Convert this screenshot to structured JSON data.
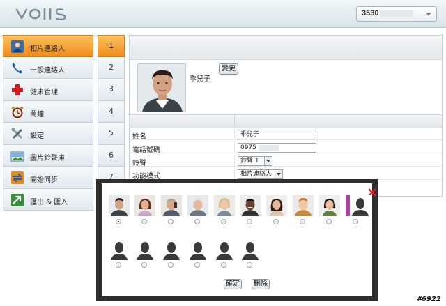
{
  "header": {
    "logo_text": "VOIIS",
    "account_prefix": "3530"
  },
  "sidebar": {
    "items": [
      {
        "label": "相片連絡人",
        "icon": "contact-person-icon",
        "active": true
      },
      {
        "label": "一般連絡人",
        "icon": "phone-icon",
        "active": false
      },
      {
        "label": "健康管理",
        "icon": "health-cross-icon",
        "active": false
      },
      {
        "label": "鬧鐘",
        "icon": "alarm-clock-icon",
        "active": false
      },
      {
        "label": "設定",
        "icon": "tools-icon",
        "active": false
      },
      {
        "label": "圖片鈴聲庫",
        "icon": "image-library-icon",
        "active": false
      },
      {
        "label": "開始同步",
        "icon": "sync-icon",
        "active": false
      },
      {
        "label": "匯出 & 匯入",
        "icon": "export-import-icon",
        "active": false
      }
    ]
  },
  "slots": [
    "1",
    "2",
    "3",
    "4",
    "5",
    "6",
    "7"
  ],
  "contact": {
    "name": "乖兒子",
    "change_label": "變更"
  },
  "form": {
    "rows": [
      {
        "label": "姓名",
        "value": "乖兒子"
      },
      {
        "label": "電話號碼",
        "value": "0975"
      },
      {
        "label": "鈴聲",
        "value": "鈴聲 1"
      },
      {
        "label": "功能模式",
        "value": "相片連絡人"
      }
    ]
  },
  "dialog": {
    "ok_label": "確定",
    "delete_label": "刪除",
    "selected_index": 0
  },
  "watermark": "#6922",
  "colors": {
    "active_orange": "#f39a2a",
    "dialog_border": "#2e2e2e",
    "close_red": "#e02020"
  }
}
